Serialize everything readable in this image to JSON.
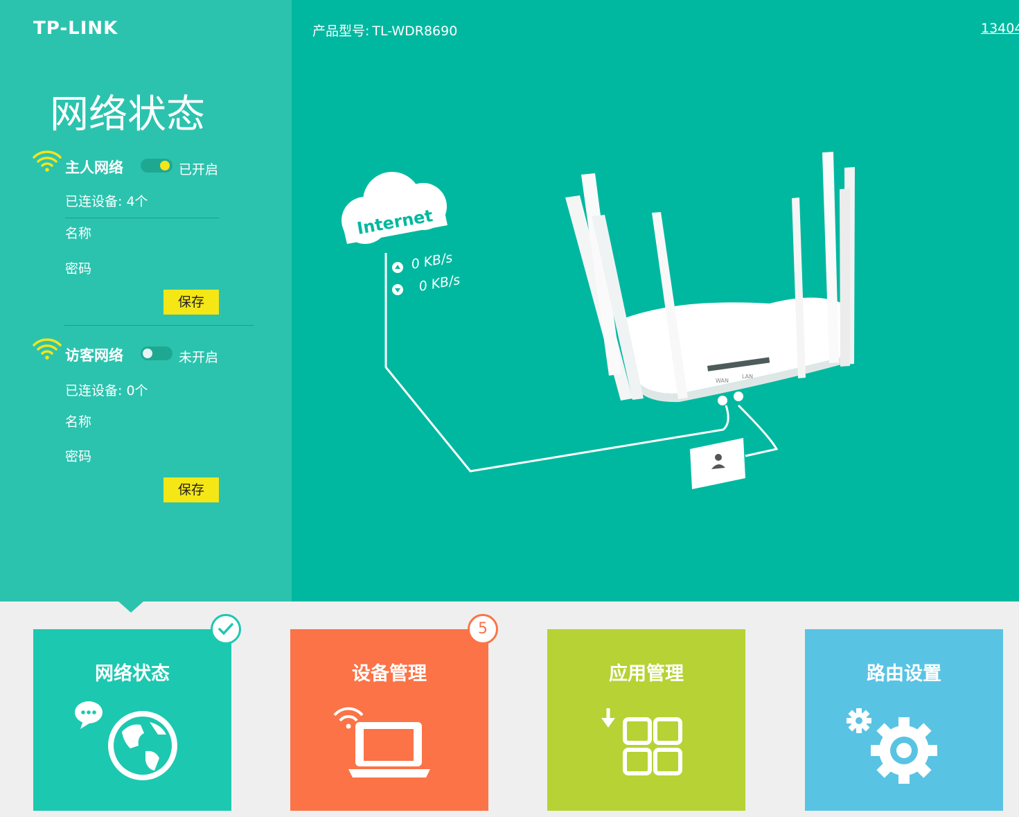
{
  "brand": {
    "logo": "TP-LINK"
  },
  "header": {
    "model_label": "产品型号:",
    "model_value": "TL-WDR8690",
    "user_link": "13404"
  },
  "sidebar": {
    "title": "网络状态",
    "main_network": {
      "name": "主人网络",
      "toggle_state": "on",
      "status": "已开启",
      "connected_devices": "已连设备: 4个",
      "name_label": "名称",
      "password_label": "密码",
      "save_label": "保存"
    },
    "guest_network": {
      "name": "访客网络",
      "toggle_state": "off",
      "status": "未开启",
      "connected_devices": "已连设备: 0个",
      "name_label": "名称",
      "password_label": "密码",
      "save_label": "保存"
    }
  },
  "diagram": {
    "cloud_label": "Internet",
    "upload_speed": "0 KB/s",
    "download_speed": "0 KB/s",
    "port_wan": "WAN",
    "port_lan": "LAN"
  },
  "tiles": [
    {
      "label": "网络状态",
      "color": "#1cc8b0",
      "icon": "globe-chat-icon",
      "selected": true
    },
    {
      "label": "设备管理",
      "color": "#fb7347",
      "icon": "laptop-wifi-icon",
      "badge": "5"
    },
    {
      "label": "应用管理",
      "color": "#b6d234",
      "icon": "apps-grid-icon"
    },
    {
      "label": "路由设置",
      "color": "#59c3e4",
      "icon": "gear-icon"
    }
  ],
  "colors": {
    "left_panel": "#2bc3ae",
    "right_panel": "#00b8a0",
    "save_button": "#f5e616",
    "wifi_icon": "#f3e51b",
    "bottom_bg": "#efefef"
  }
}
